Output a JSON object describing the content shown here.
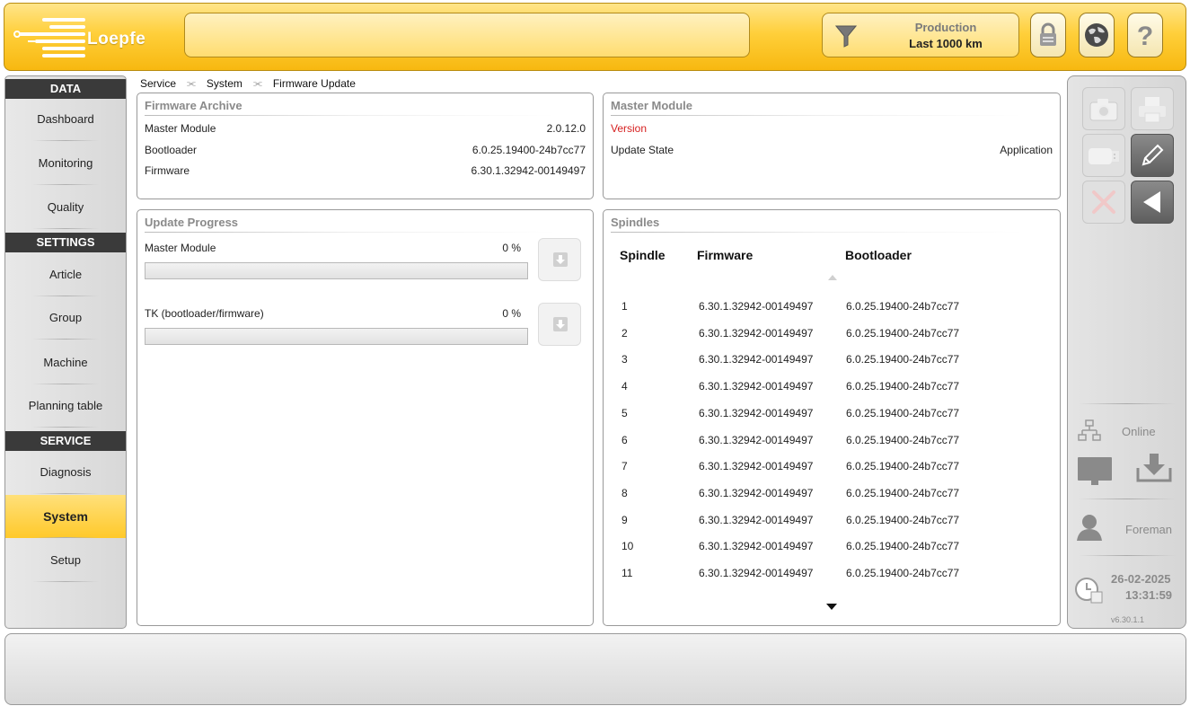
{
  "header": {
    "brand": "Loepfe",
    "filter": {
      "line1": "Production",
      "line2": "Last 1000 km"
    }
  },
  "nav": {
    "data_header": "DATA",
    "data_items": [
      "Dashboard",
      "Monitoring",
      "Quality"
    ],
    "settings_header": "SETTINGS",
    "settings_items": [
      "Article",
      "Group",
      "Machine",
      "Planning table"
    ],
    "service_header": "SERVICE",
    "service_items": [
      "Diagnosis",
      "System",
      "Setup"
    ],
    "active": "System"
  },
  "breadcrumb": [
    "Service",
    "System",
    "Firmware Update"
  ],
  "firmware_archive": {
    "title": "Firmware Archive",
    "rows": [
      {
        "label": "Master Module",
        "value": "2.0.12.0"
      },
      {
        "label": "Bootloader",
        "value": "6.0.25.19400-24b7cc77"
      },
      {
        "label": "Firmware",
        "value": "6.30.1.32942-00149497"
      }
    ]
  },
  "master_module": {
    "title": "Master Module",
    "version_label": "Version",
    "update_state_label": "Update State",
    "update_state_value": "Application",
    "version_color": "#d62020"
  },
  "update_progress": {
    "title": "Update Progress",
    "items": [
      {
        "label": "Master Module",
        "percent_text": "0 %",
        "percent": 0
      },
      {
        "label": "TK (bootloader/firmware)",
        "percent_text": "0 %",
        "percent": 0
      }
    ]
  },
  "spindles": {
    "title": "Spindles",
    "columns": [
      "Spindle",
      "Firmware",
      "Bootloader"
    ],
    "rows": [
      [
        "1",
        "6.30.1.32942-00149497",
        "6.0.25.19400-24b7cc77"
      ],
      [
        "2",
        "6.30.1.32942-00149497",
        "6.0.25.19400-24b7cc77"
      ],
      [
        "3",
        "6.30.1.32942-00149497",
        "6.0.25.19400-24b7cc77"
      ],
      [
        "4",
        "6.30.1.32942-00149497",
        "6.0.25.19400-24b7cc77"
      ],
      [
        "5",
        "6.30.1.32942-00149497",
        "6.0.25.19400-24b7cc77"
      ],
      [
        "6",
        "6.30.1.32942-00149497",
        "6.0.25.19400-24b7cc77"
      ],
      [
        "7",
        "6.30.1.32942-00149497",
        "6.0.25.19400-24b7cc77"
      ],
      [
        "8",
        "6.30.1.32942-00149497",
        "6.0.25.19400-24b7cc77"
      ],
      [
        "9",
        "6.30.1.32942-00149497",
        "6.0.25.19400-24b7cc77"
      ],
      [
        "10",
        "6.30.1.32942-00149497",
        "6.0.25.19400-24b7cc77"
      ],
      [
        "11",
        "6.30.1.32942-00149497",
        "6.0.25.19400-24b7cc77"
      ]
    ]
  },
  "status": {
    "connection": "Online",
    "user": "Foreman",
    "date": "26-02-2025",
    "time": "13:31:59",
    "version": "v6.30.1.1"
  },
  "icons": {
    "filter": "filter-icon",
    "lock": "lock-icon",
    "globe": "globe-icon",
    "help": "help-icon",
    "camera": "camera-icon",
    "print": "print-icon",
    "usb": "usb-icon",
    "edit": "pencil-icon",
    "cancel": "cancel-icon",
    "back": "back-arrow-icon",
    "network": "network-icon",
    "monitor": "monitor-icon",
    "download": "download-icon",
    "user": "user-icon",
    "clock": "clock-calendar-icon"
  },
  "colors": {
    "accent": "#ffc92a",
    "dark_header": "#3a3a3a",
    "muted_title": "#8a8a8a"
  }
}
